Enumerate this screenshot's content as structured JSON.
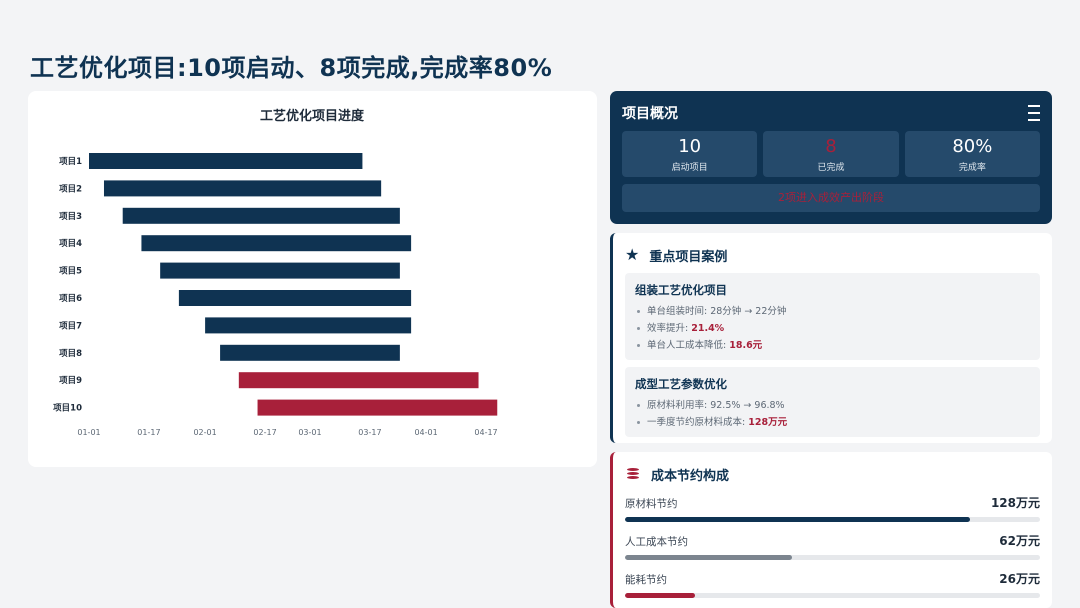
{
  "page": {
    "title": "工艺优化项目:10项启动、8项完成,完成率80%"
  },
  "chart_data": {
    "type": "bar",
    "orientation": "horizontal-gantt",
    "title": "工艺优化项目进度",
    "xlabel": "",
    "ylabel": "",
    "categories": [
      "项目1",
      "项目2",
      "项目3",
      "项目4",
      "项目5",
      "项目6",
      "项目7",
      "项目8",
      "项目9",
      "项目10"
    ],
    "x_ticks": [
      "01-01",
      "01-17",
      "02-01",
      "02-17",
      "03-01",
      "03-17",
      "04-01",
      "04-17"
    ],
    "x_tick_days": [
      0,
      16,
      31,
      47,
      59,
      75,
      90,
      106
    ],
    "start_days": [
      0,
      4,
      9,
      14,
      19,
      24,
      31,
      35,
      40,
      45
    ],
    "end_days": [
      73,
      78,
      83,
      86,
      83,
      86,
      86,
      83,
      104,
      109
    ],
    "status": [
      "done",
      "done",
      "done",
      "done",
      "done",
      "done",
      "done",
      "done",
      "ongoing",
      "ongoing"
    ],
    "xlim_days": [
      0,
      110
    ],
    "colors": {
      "done": "#0f3352",
      "ongoing": "#a8203a"
    },
    "grid": false,
    "legend": "none"
  },
  "overview": {
    "title": "项目概况",
    "icon": "list-check-icon",
    "stats": [
      {
        "value": "10",
        "label": "启动项目"
      },
      {
        "value": "8",
        "label": "已完成"
      },
      {
        "value": "80%",
        "label": "完成率"
      }
    ],
    "note": "2项进入成效产出阶段"
  },
  "cases": {
    "title": "重点项目案例",
    "icon": "star-icon",
    "items": [
      {
        "title": "组装工艺优化项目",
        "lines": [
          {
            "text": "单台组装时间: 28分钟 → 22分钟",
            "highlight": ""
          },
          {
            "text": "效率提升: ",
            "highlight": "21.4%"
          },
          {
            "text": "单台人工成本降低: ",
            "highlight": "18.6元"
          }
        ]
      },
      {
        "title": "成型工艺参数优化",
        "lines": [
          {
            "text": "原材料利用率: 92.5% → 96.8%",
            "highlight": ""
          },
          {
            "text": "一季度节约原材料成本: ",
            "highlight": "128万元"
          }
        ]
      }
    ]
  },
  "savings": {
    "title": "成本节约构成",
    "icon": "coins-icon",
    "items": [
      {
        "label": "原材料节约",
        "amount": "128万元",
        "value": 128,
        "color": "#0f3352"
      },
      {
        "label": "人工成本节约",
        "amount": "62万元",
        "value": 62,
        "color": "#7c858f"
      },
      {
        "label": "能耗节约",
        "amount": "26万元",
        "value": 26,
        "color": "#a8203a"
      }
    ],
    "scale_max": 154
  }
}
